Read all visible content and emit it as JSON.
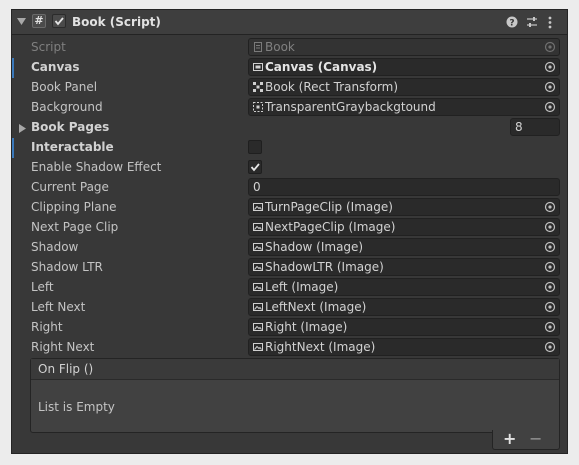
{
  "component": {
    "title": "Book (Script)",
    "script_label": "Script",
    "script_value": "Book",
    "help_icon": "help-icon",
    "preset_icon": "sliders-icon",
    "menu_icon": "kebab-menu-icon"
  },
  "fields": {
    "canvas": {
      "label": "Canvas",
      "value": "Canvas (Canvas)"
    },
    "book_panel": {
      "label": "Book Panel",
      "value": "Book (Rect Transform)"
    },
    "background": {
      "label": "Background",
      "value": "TransparentGraybackgtound"
    },
    "book_pages": {
      "label": "Book Pages",
      "value": "8"
    },
    "interactable": {
      "label": "Interactable",
      "checked": false
    },
    "shadow_effect": {
      "label": "Enable Shadow Effect",
      "checked": true
    },
    "current_page": {
      "label": "Current Page",
      "value": "0"
    },
    "clipping_plane": {
      "label": "Clipping Plane",
      "value": "TurnPageClip (Image)"
    },
    "next_page_clip": {
      "label": "Next Page Clip",
      "value": "NextPageClip (Image)"
    },
    "shadow": {
      "label": "Shadow",
      "value": "Shadow (Image)"
    },
    "shadow_ltr": {
      "label": "Shadow LTR",
      "value": "ShadowLTR (Image)"
    },
    "left": {
      "label": "Left",
      "value": "Left (Image)"
    },
    "left_next": {
      "label": "Left Next",
      "value": "LeftNext (Image)"
    },
    "right": {
      "label": "Right",
      "value": "Right (Image)"
    },
    "right_next": {
      "label": "Right Next",
      "value": "RightNext (Image)"
    }
  },
  "event": {
    "title": "On Flip ()",
    "empty_text": "List is Empty",
    "add_label": "+",
    "remove_label": "−"
  },
  "colors": {
    "panel": "#383838",
    "field": "#2a2a2a",
    "accent": "#3a79bb"
  }
}
